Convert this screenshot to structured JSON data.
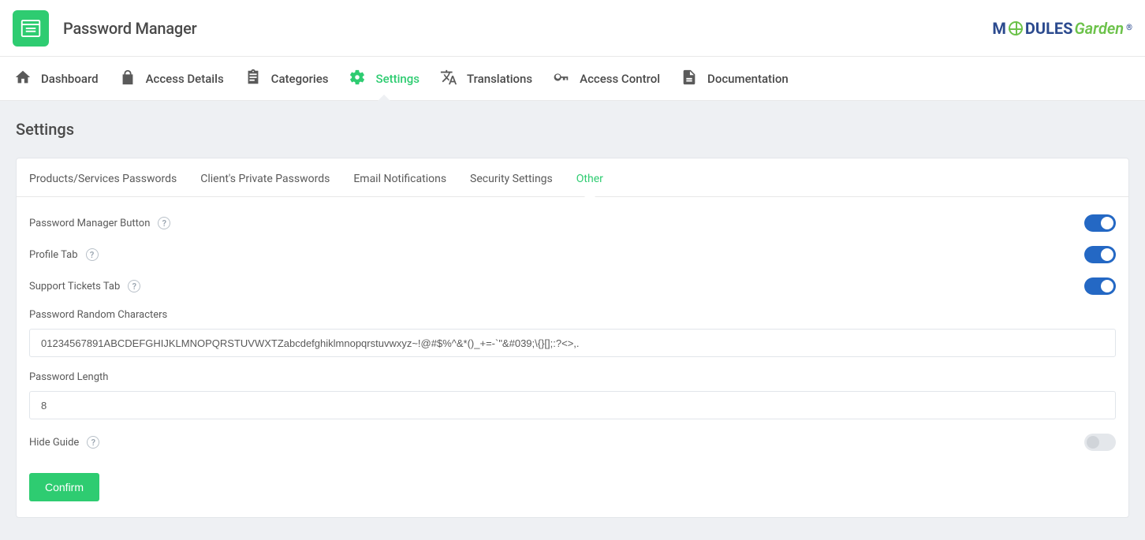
{
  "header": {
    "app_title": "Password Manager",
    "brand_main": "MODULES",
    "brand_accent": "Garden"
  },
  "nav": {
    "dashboard": "Dashboard",
    "access_details": "Access Details",
    "categories": "Categories",
    "settings": "Settings",
    "translations": "Translations",
    "access_control": "Access Control",
    "documentation": "Documentation"
  },
  "page_title": "Settings",
  "tabs": {
    "products": "Products/Services Passwords",
    "private": "Client's Private Passwords",
    "email": "Email Notifications",
    "security": "Security Settings",
    "other": "Other"
  },
  "form": {
    "pm_button_label": "Password Manager Button",
    "profile_tab_label": "Profile Tab",
    "support_tickets_label": "Support Tickets Tab",
    "random_chars_label": "Password Random Characters",
    "random_chars_value": "01234567891ABCDEFGHIJKLMNOPQRSTUVWXTZabcdefghiklmnopqrstuvwxyz~!@#$%^&*()_+=-`\"&#039;\\{}[];:?<>,.",
    "length_label": "Password Length",
    "length_value": "8",
    "hide_guide_label": "Hide Guide",
    "confirm_label": "Confirm",
    "toggles": {
      "pm_button": true,
      "profile_tab": true,
      "support_tickets": true,
      "hide_guide": false
    }
  }
}
